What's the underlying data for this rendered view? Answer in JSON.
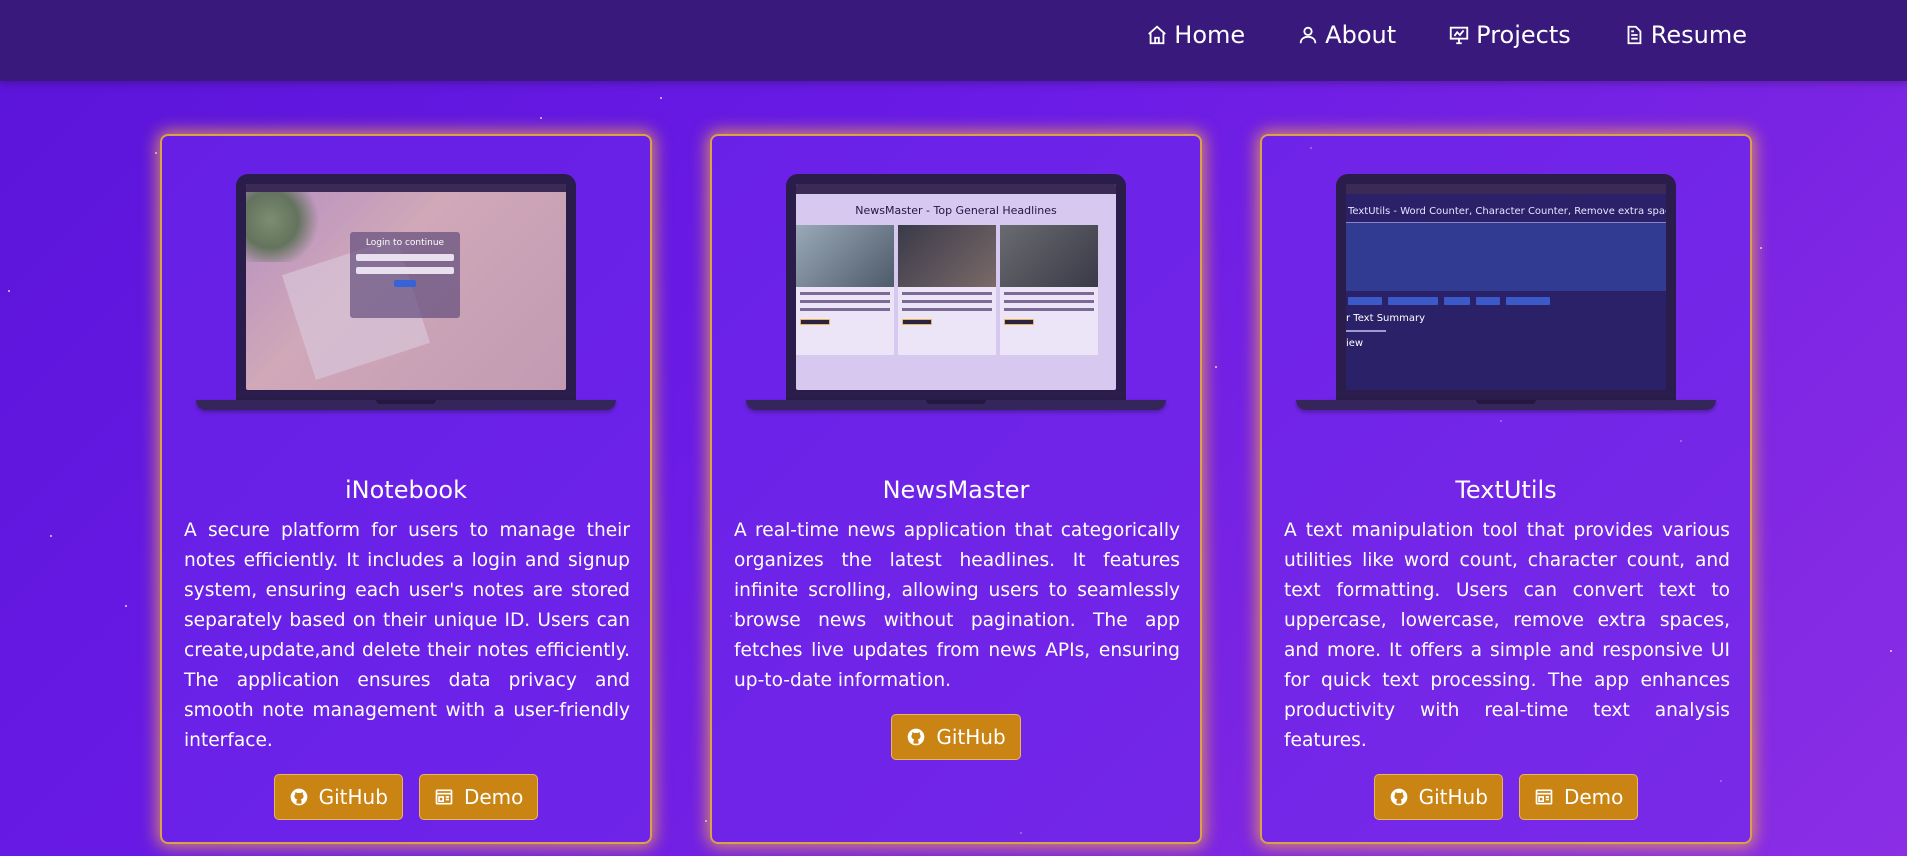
{
  "nav": {
    "items": [
      {
        "label": "Home",
        "icon": "home-icon"
      },
      {
        "label": "About",
        "icon": "user-icon"
      },
      {
        "label": "Projects",
        "icon": "presentation-icon"
      },
      {
        "label": "Resume",
        "icon": "document-icon"
      }
    ]
  },
  "colors": {
    "background": "#6a1be6",
    "navbar": "#391a7c",
    "card_border": "#d9a24a",
    "button": "#c98413"
  },
  "projects": [
    {
      "title": "iNotebook",
      "description": "A secure platform for users to manage their notes efficiently. It includes a login and signup system, ensuring each user's notes are stored separately based on their unique ID. Users can create,update,and delete their notes efficiently. The application ensures data privacy and smooth note management with a user-friendly interface.",
      "screen_text": "Login to continue",
      "buttons": {
        "github": "GitHub",
        "demo": "Demo"
      }
    },
    {
      "title": "NewsMaster",
      "description": "A real-time news application that categorically organizes the latest headlines. It features infinite scrolling, allowing users to seamlessly browse news without pagination. The app fetches live updates from news APIs, ensuring up-to-date information.",
      "screen_text": "NewsMaster - Top General Headlines",
      "buttons": {
        "github": "GitHub"
      }
    },
    {
      "title": "TextUtils",
      "description": "A text manipulation tool that provides various utilities like word count, character count, and text formatting. Users can convert text to uppercase, lowercase, remove extra spaces, and more. It offers a simple and responsive UI for quick text processing. The app enhances productivity with real-time text analysis features.",
      "screen_text": "TextUtils - Word Counter, Character Counter, Remove extra spac",
      "screen_summary": "r Text Summary",
      "screen_preview": "iew",
      "buttons": {
        "github": "GitHub",
        "demo": "Demo"
      }
    }
  ]
}
